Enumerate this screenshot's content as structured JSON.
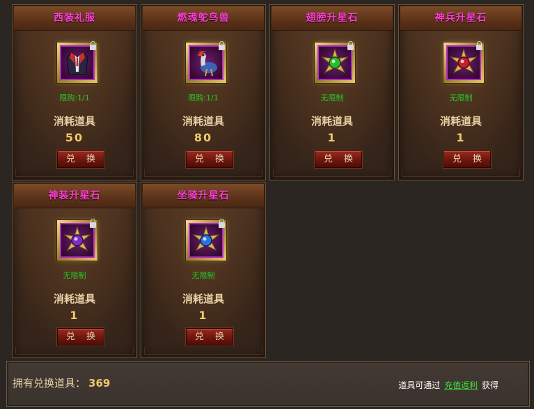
{
  "items": [
    {
      "name": "西装礼服",
      "limit": "限购:1/1",
      "label": "消耗道具",
      "cost": "50",
      "button": "兑 换",
      "icon": "suit-icon"
    },
    {
      "name": "燃魂鸵鸟兽",
      "limit": "限购:1/1",
      "label": "消耗道具",
      "cost": "80",
      "button": "兑 换",
      "icon": "ostrich-mount-icon"
    },
    {
      "name": "翅膀升星石",
      "limit": "无限制",
      "label": "消耗道具",
      "cost": "1",
      "button": "兑 换",
      "icon": "green-star-stone-icon"
    },
    {
      "name": "神兵升星石",
      "limit": "无限制",
      "label": "消耗道具",
      "cost": "1",
      "button": "兑 换",
      "icon": "red-star-stone-icon"
    },
    {
      "name": "神装升星石",
      "limit": "无限制",
      "label": "消耗道具",
      "cost": "1",
      "button": "兑 换",
      "icon": "purple-star-stone-icon"
    },
    {
      "name": "坐骑升星石",
      "limit": "无限制",
      "label": "消耗道具",
      "cost": "1",
      "button": "兑 换",
      "icon": "blue-star-stone-icon"
    }
  ],
  "footer": {
    "owned_label": "拥有兑换道具：",
    "owned_count": "369",
    "hint_prefix": "道具可通过",
    "hint_link": "充值返利",
    "hint_suffix": "获得"
  },
  "colors": {
    "title": "#ff3fd0",
    "limit": "#27c82a",
    "cost": "#f2c86a",
    "link": "#3ce03c"
  }
}
